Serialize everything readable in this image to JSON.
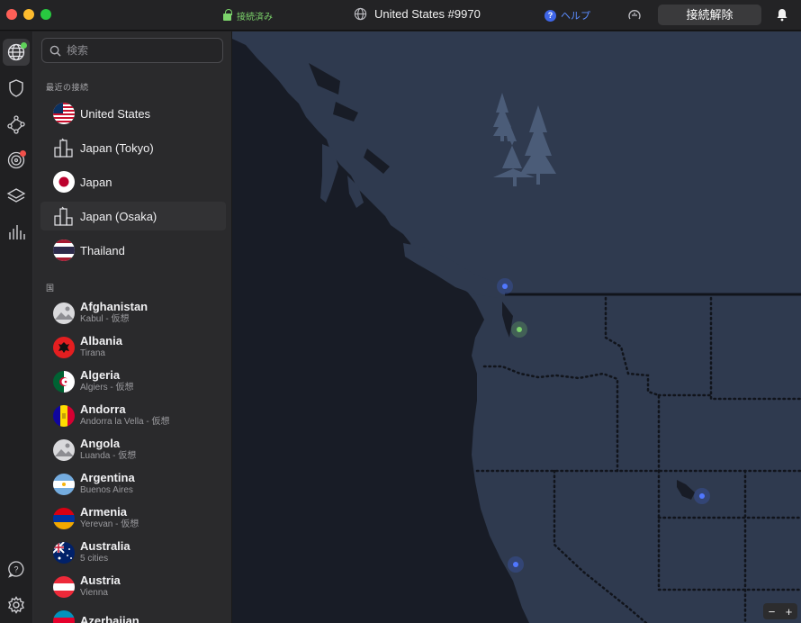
{
  "titlebar": {
    "status": "接続済み",
    "server": "United States #9970",
    "help": "ヘルプ",
    "disconnect": "接続解除"
  },
  "rail": {
    "icons": [
      "globe-icon",
      "shield-icon",
      "meshnet-icon",
      "target-icon",
      "layers-icon",
      "stats-icon",
      "support-icon",
      "settings-icon"
    ]
  },
  "search": {
    "placeholder": "検索"
  },
  "recent": {
    "title": "最近の接続",
    "items": [
      {
        "label": "United States",
        "flag": "us"
      },
      {
        "label": "Japan (Tokyo)",
        "flag": "city"
      },
      {
        "label": "Japan",
        "flag": "jp"
      },
      {
        "label": "Japan (Osaka)",
        "flag": "city"
      },
      {
        "label": "Thailand",
        "flag": "th"
      }
    ]
  },
  "countries": {
    "title": "国",
    "items": [
      {
        "name": "Afghanistan",
        "sub": "Kabul - 仮想",
        "flag": "generic"
      },
      {
        "name": "Albania",
        "sub": "Tirana",
        "flag": "al"
      },
      {
        "name": "Algeria",
        "sub": "Algiers - 仮想",
        "flag": "dz"
      },
      {
        "name": "Andorra",
        "sub": "Andorra la Vella - 仮想",
        "flag": "ad"
      },
      {
        "name": "Angola",
        "sub": "Luanda - 仮想",
        "flag": "generic"
      },
      {
        "name": "Argentina",
        "sub": "Buenos Aires",
        "flag": "ar"
      },
      {
        "name": "Armenia",
        "sub": "Yerevan - 仮想",
        "flag": "am"
      },
      {
        "name": "Australia",
        "sub": "5 cities",
        "flag": "au"
      },
      {
        "name": "Austria",
        "sub": "Vienna",
        "flag": "at"
      },
      {
        "name": "Azerbaijan",
        "sub": "",
        "flag": "az"
      }
    ]
  },
  "colors": {
    "accent_blue": "#3f66e8",
    "connected_green": "#7cd36b",
    "map_land": "#2f3a4f",
    "map_water": "#181c26"
  }
}
